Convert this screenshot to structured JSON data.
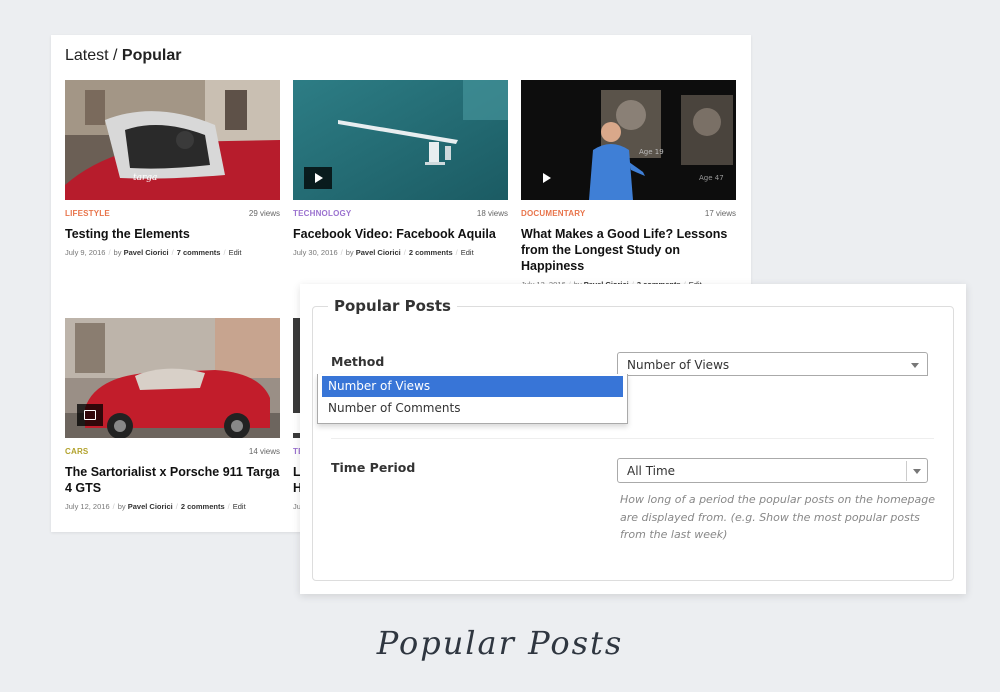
{
  "blog": {
    "title_prefix": "Latest / ",
    "title_bold": "Popular",
    "posts": [
      {
        "category": "LIFESTYLE",
        "category_color": "#e8744b",
        "views": "29 views",
        "title": "Testing the Elements",
        "date": "July 9, 2016",
        "author_prefix": "by ",
        "author": "Pavel Ciorici",
        "comments": "7 comments",
        "edit": "Edit"
      },
      {
        "category": "TECHNOLOGY",
        "category_color": "#9b72cf",
        "views": "18 views",
        "title": "Facebook Video: Facebook Aquila",
        "date": "July 30, 2016",
        "author_prefix": "by ",
        "author": "Pavel Ciorici",
        "comments": "2 comments",
        "edit": "Edit"
      },
      {
        "category": "DOCUMENTARY",
        "category_color": "#e8744b",
        "views": "17 views",
        "title": "What Makes a Good Life? Lessons from the Longest Study on Happiness",
        "date": "July 13, 2016",
        "author_prefix": "by ",
        "author": "Pavel Ciorici",
        "comments": "3 comments",
        "edit": "Edit"
      },
      {
        "category": "CARS",
        "category_color": "#b2a22c",
        "views": "14 views",
        "title": "The Sartorialist x Porsche 911 Targa 4 GTS",
        "date": "July 12, 2016",
        "author_prefix": "by ",
        "author": "Pavel Ciorici",
        "comments": "2 comments",
        "edit": "Edit"
      },
      {
        "category": "TE",
        "category_color": "#9b72cf",
        "title_line1": "L",
        "title_line2": "H",
        "date": "Ju"
      }
    ]
  },
  "panel": {
    "legend": "Popular Posts",
    "method_label": "Method",
    "method_value": "Number of Views",
    "method_options": [
      "Number of Views",
      "Number of Comments"
    ],
    "time_label": "Time Period",
    "time_value": "All Time",
    "help_text": "How long of a period the popular posts on the homepage are displayed from. (e.g. Show the most popular posts from the last week)"
  },
  "caption": "Popular  Posts"
}
